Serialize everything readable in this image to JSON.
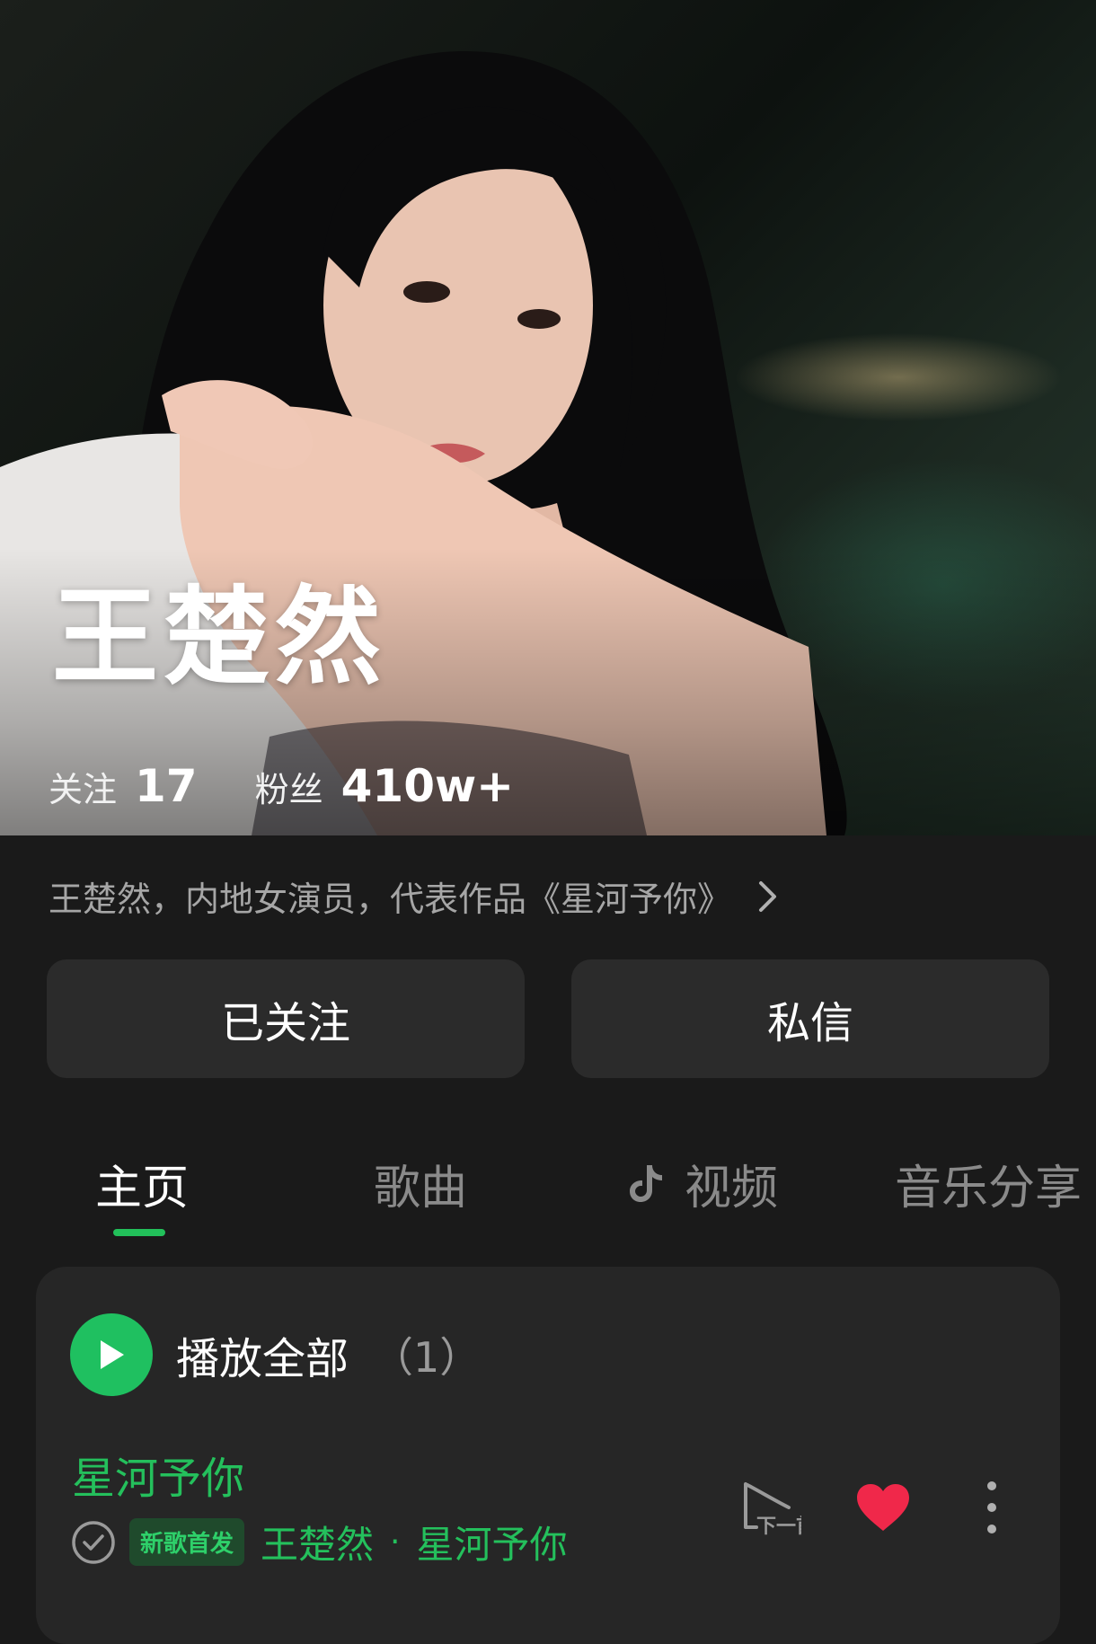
{
  "header": {
    "artist_name": "王楚然",
    "stats": [
      {
        "label": "关注",
        "value": "17"
      },
      {
        "label": "粉丝",
        "value": "410w+"
      }
    ]
  },
  "bio": {
    "text": "王楚然，内地女演员，代表作品《星河予你》"
  },
  "actions": {
    "follow_label": "已关注",
    "message_label": "私信"
  },
  "tabs": [
    {
      "label": "主页",
      "active": true
    },
    {
      "label": "歌曲",
      "active": false
    },
    {
      "label": "视频",
      "active": false,
      "icon": "tiktok-icon"
    },
    {
      "label": "音乐分享",
      "active": false
    }
  ],
  "song_list": {
    "play_all_label": "播放全部",
    "count": "（1）",
    "songs": [
      {
        "title": "星河予你",
        "badge": "新歌首发",
        "artist": "王楚然",
        "separator": "·",
        "album": "星河予你",
        "liked": true,
        "next_label": "下一首"
      }
    ]
  },
  "colors": {
    "accent": "#1fc060",
    "heart": "#f0284a",
    "background": "#1a1a1a",
    "card": "#262626"
  }
}
